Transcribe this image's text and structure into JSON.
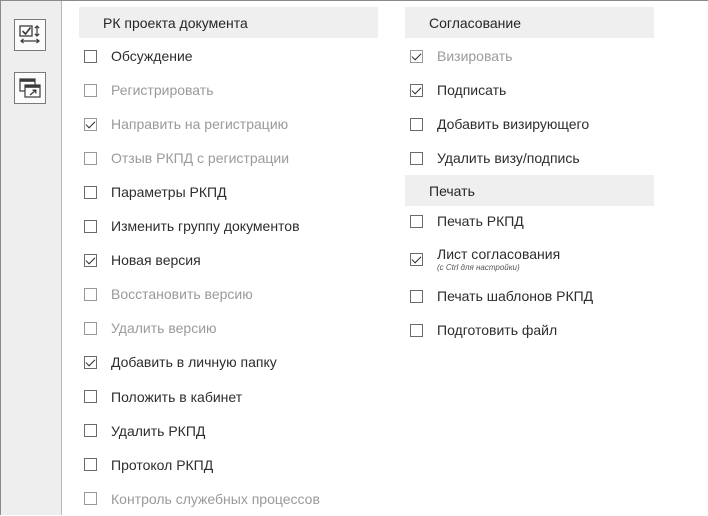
{
  "left_section": {
    "title": "РК проекта документа",
    "items": [
      {
        "label": "Обсуждение",
        "checked": false,
        "disabled": false
      },
      {
        "label": "Регистрировать",
        "checked": false,
        "disabled": true
      },
      {
        "label": "Направить на регистрацию",
        "checked": true,
        "disabled": true
      },
      {
        "label": "Отзыв РКПД с регистрации",
        "checked": false,
        "disabled": true
      },
      {
        "label": "Параметры РКПД",
        "checked": false,
        "disabled": false
      },
      {
        "label": "Изменить группу документов",
        "checked": false,
        "disabled": false
      },
      {
        "label": "Новая версия",
        "checked": true,
        "disabled": false
      },
      {
        "label": "Восстановить версию",
        "checked": false,
        "disabled": true
      },
      {
        "label": "Удалить версию",
        "checked": false,
        "disabled": true
      },
      {
        "label": "Добавить в личную папку",
        "checked": true,
        "disabled": false
      },
      {
        "label": "Положить в кабинет",
        "checked": false,
        "disabled": false
      },
      {
        "label": "Удалить РКПД",
        "checked": false,
        "disabled": false
      },
      {
        "label": "Протокол РКПД",
        "checked": false,
        "disabled": false
      },
      {
        "label": "Контроль служебных процессов",
        "checked": false,
        "disabled": true
      }
    ]
  },
  "approval_section": {
    "title": "Согласование",
    "items": [
      {
        "label": "Визировать",
        "checked": true,
        "disabled": true
      },
      {
        "label": "Подписать",
        "checked": true,
        "disabled": false
      },
      {
        "label": "Добавить визирующего",
        "checked": false,
        "disabled": false
      },
      {
        "label": "Удалить визу/подпись",
        "checked": false,
        "disabled": false
      }
    ]
  },
  "print_section": {
    "title": "Печать",
    "items": [
      {
        "label": "Печать РКПД",
        "checked": false,
        "disabled": false
      },
      {
        "label": "Лист согласования",
        "hint": "(с Ctrl для настройки)",
        "checked": true,
        "disabled": false
      },
      {
        "label": "Печать шаблонов РКПД",
        "checked": false,
        "disabled": false
      },
      {
        "label": "Подготовить файл",
        "checked": false,
        "disabled": false
      }
    ]
  },
  "toolbar": {
    "buttons": [
      {
        "icon": "check-sort-icon"
      },
      {
        "icon": "window-export-icon"
      }
    ]
  }
}
